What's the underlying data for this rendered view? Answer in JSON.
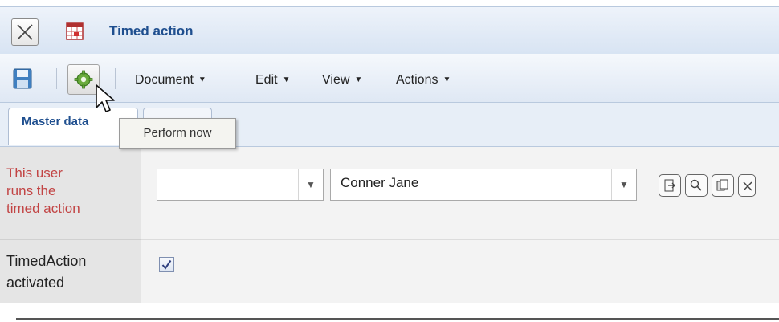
{
  "window": {
    "title": "Timed action",
    "close_icon": "close-icon",
    "app_icon": "calendar-icon"
  },
  "toolbar": {
    "save_icon": "save-icon",
    "perform_icon": "gear-icon",
    "menus": [
      {
        "label": "Document"
      },
      {
        "label": "Edit"
      },
      {
        "label": "View"
      },
      {
        "label": "Actions"
      }
    ]
  },
  "tooltip": {
    "text": "Perform now"
  },
  "tabs": [
    {
      "label": "Master data",
      "active": true
    },
    {
      "label": "",
      "active": false
    }
  ],
  "form": {
    "user_row": {
      "label": "This user runs the timed action",
      "label_lines": [
        "This user",
        "runs the",
        "timed action"
      ],
      "first_select_value": "",
      "second_select_value": "Conner Jane",
      "icons": [
        "open-icon",
        "search-icon",
        "copy-icon",
        "clear-icon"
      ]
    },
    "activated_row": {
      "label_lines": [
        "TimedAction",
        "activated"
      ],
      "checked": true
    }
  },
  "colors": {
    "title": "#1f4f8f",
    "required_label": "#c24444",
    "label_bg": "#e5e5e5"
  }
}
